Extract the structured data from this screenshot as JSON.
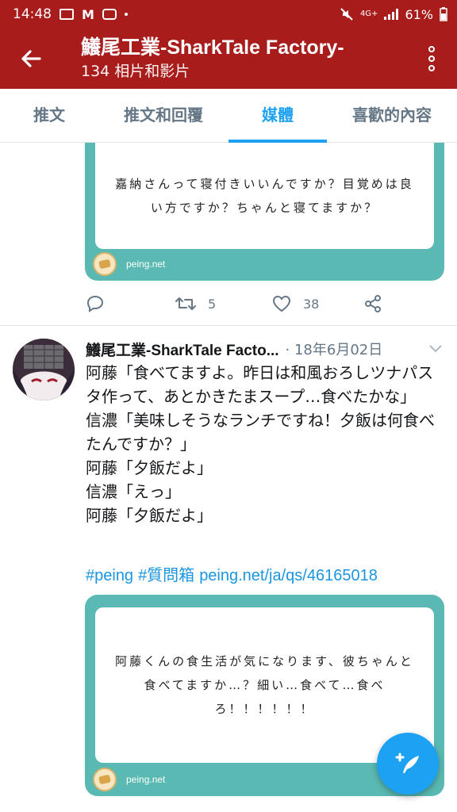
{
  "statusbar": {
    "time": "14:48",
    "network": "4G+",
    "battery": "61%"
  },
  "header": {
    "title": "鱶尾工業-SharkTale Factory-",
    "subtitle": "134 相片和影片"
  },
  "tabs": [
    {
      "label": "推文",
      "active": false
    },
    {
      "label": "推文和回覆",
      "active": false
    },
    {
      "label": "媒體",
      "active": true
    },
    {
      "label": "喜歡的內容",
      "active": false
    }
  ],
  "first_card": {
    "text": "嘉納さんって寝付きいいんですか？目覚めは良い方ですか？ちゃんと寝てますか？",
    "domain": "peing.net"
  },
  "actions": {
    "retweets": "5",
    "likes": "38"
  },
  "tweet": {
    "author": "鱶尾工業-SharkTale Facto...",
    "date": "· 18年6月02日",
    "lines": [
      "阿藤「食べてますよ。昨日は和風おろしツナパスタ作って、あとかきたまスープ…食べたかな」",
      "信濃「美味しそうなランチですね！夕飯は何食べたんですか？」",
      "阿藤「夕飯だよ」",
      "信濃「えっ」",
      "阿藤「夕飯だよ」"
    ],
    "hashtag1": "#peing",
    "hashtag2": "#質問箱",
    "link": "peing.net/ja/qs/46165018"
  },
  "second_card": {
    "text": "阿藤くんの食生活が気になります、彼ちゃんと食べてますか…？細い…食べて…食べろ！！！！！！",
    "domain": "peing.net"
  },
  "colors": {
    "header": "#a81c1c",
    "accent": "#1da1f2",
    "card": "#5ab9b3"
  },
  "icons": [
    "back-arrow-icon",
    "more-vertical-icon",
    "reply-icon",
    "retweet-icon",
    "like-heart-icon",
    "share-icon",
    "chevron-down-icon",
    "compose-tweet-icon"
  ]
}
